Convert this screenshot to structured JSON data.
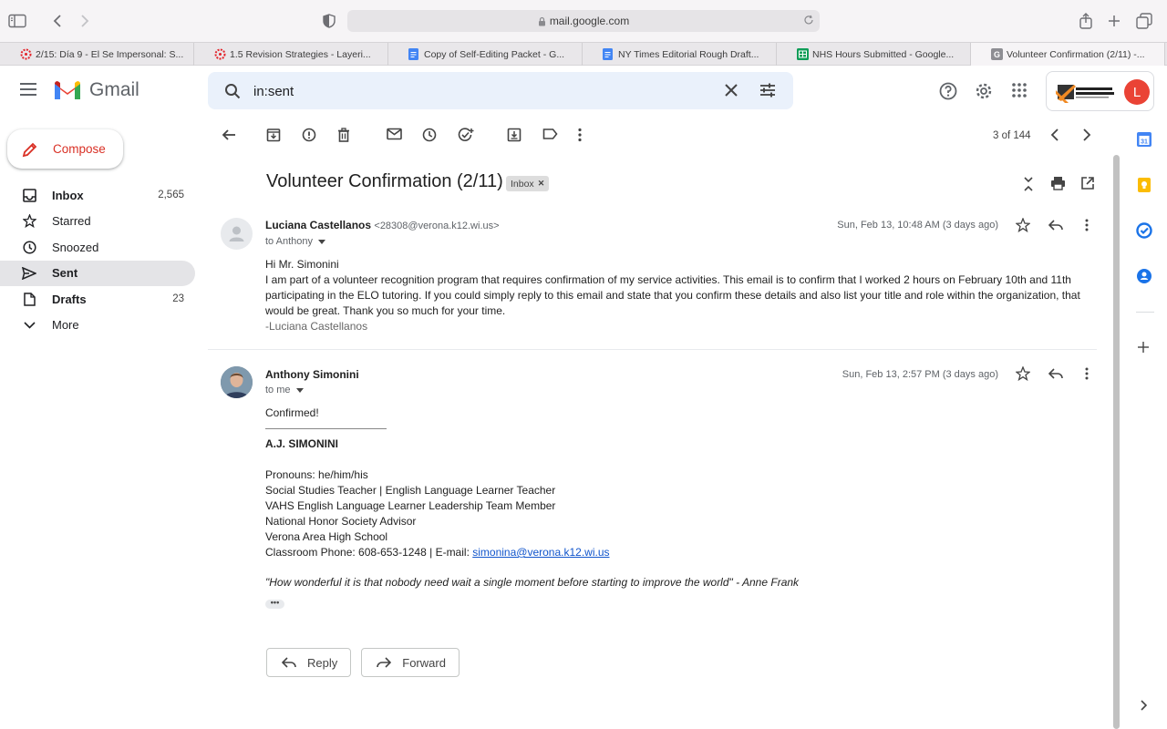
{
  "browser": {
    "url": "mail.google.com",
    "tabs": [
      {
        "title": "2/15: Día 9 - El Se Impersonal: S...",
        "favicon": "canvas-icon"
      },
      {
        "title": "1.5 Revision Strategies - Layeri...",
        "favicon": "canvas-icon"
      },
      {
        "title": "Copy of Self-Editing Packet - G...",
        "favicon": "google-docs-icon"
      },
      {
        "title": "NY Times Editorial Rough Draft...",
        "favicon": "google-docs-icon"
      },
      {
        "title": "NHS Hours Submitted - Google...",
        "favicon": "google-sheets-icon"
      },
      {
        "title": "Volunteer Confirmation (2/11) -...",
        "favicon": "gmail-g-icon",
        "active": true
      }
    ]
  },
  "header": {
    "app_name": "Gmail",
    "search_value": "in:sent",
    "account_initial": "L",
    "account_color": "#ea4335",
    "org_name": "Verona Area School District"
  },
  "sidebar": {
    "compose_label": "Compose",
    "items": [
      {
        "label": "Inbox",
        "count": "2,565",
        "icon": "inbox-icon"
      },
      {
        "label": "Starred",
        "count": "",
        "icon": "star-icon"
      },
      {
        "label": "Snoozed",
        "count": "",
        "icon": "clock-icon"
      },
      {
        "label": "Sent",
        "count": "",
        "icon": "send-icon"
      },
      {
        "label": "Drafts",
        "count": "23",
        "icon": "draft-icon"
      },
      {
        "label": "More",
        "count": "",
        "icon": "chevron-down-icon"
      }
    ]
  },
  "toolbar": {
    "page_count": "3 of 144"
  },
  "thread": {
    "subject": "Volunteer Confirmation (2/11)",
    "label": "Inbox",
    "messages": [
      {
        "sender_name": "Luciana Castellanos",
        "sender_email": "<28308@verona.k12.wi.us>",
        "to": "to Anthony",
        "date": "Sun, Feb 13, 10:48 AM (3 days ago)",
        "greeting": "Hi Mr. Simonini",
        "body": "I am part of a volunteer recognition program that requires confirmation of my service activities. This email is to confirm that I worked 2 hours on February 10th and 11th participating in the ELO tutoring. If you could simply reply to this email and state that you confirm these details and also list your title and role within the organization, that would be great. Thank you so much for your time.",
        "signoff": "-Luciana Castellanos"
      },
      {
        "sender_name": "Anthony Simonini",
        "to": "to me",
        "date": "Sun, Feb 13, 2:57 PM (3 days ago)",
        "body": "Confirmed!",
        "sig_name": "A.J. SIMONINI",
        "sig_lines": [
          "Pronouns: he/him/his",
          "Social Studies Teacher | English Language Learner Teacher",
          "VAHS English Language Learner Leadership Team Member",
          "National Honor Society Advisor",
          "Verona Area High School"
        ],
        "phone_line": "Classroom Phone: 608-653-1248 | E-mail: ",
        "email_link": "simonina@verona.k12.wi.us",
        "quote": "\"How wonderful it is that nobody need wait a single moment before starting to improve the world\" - Anne Frank",
        "more": "•••"
      }
    ],
    "reply_label": "Reply",
    "forward_label": "Forward"
  }
}
